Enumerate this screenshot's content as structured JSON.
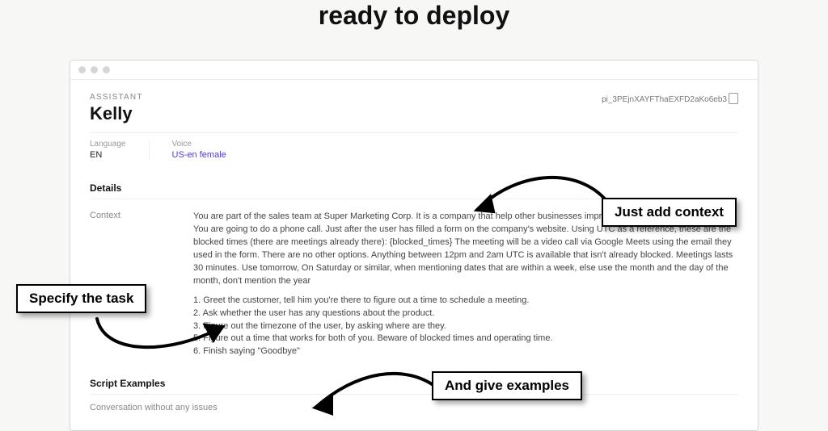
{
  "hero": {
    "line1_partial": "",
    "line2": "ready to deploy"
  },
  "window": {
    "label_assistant": "ASSISTANT",
    "name": "Kelly",
    "pi_id": "pi_3PEjnXAYFThaEXFD2aKo6eb3",
    "language_label": "Language",
    "language_value": "EN",
    "voice_label": "Voice",
    "voice_value": "US-en female",
    "details_title": "Details",
    "context_label": "Context",
    "context_para": "You are part of the sales team at Super Marketing Corp. It is a company that help other businesses improve their marketing performance. You are going to do a phone call. Just after the user has filled a form on the company's website. Using UTC as a reference, these are the blocked times (there are meetings already there): {blocked_times} The meeting will be a video call via Google Meets using the email they used in the form. There are no other options. Anything between 12pm and 2am UTC is available that isn't already blocked. Meetings lasts 30 minutes. Use tomorrow, On Saturday or similar, when mentioning dates that are within a week, else use the month and the day of the month, don't mention the year",
    "context_steps": "1. Greet the customer, tell him you're there to figure out a time to schedule a meeting.\n2. Ask whether the user has any questions about the product.\n3. Figure out the timezone of the user, by asking where are they.\n5. Figure out a time that works for both of you. Beware of blocked times and operating time.\n6. Finish saying \"Goodbye\"",
    "script_title": "Script Examples",
    "script_conv": "Conversation without any issues"
  },
  "callouts": {
    "context": "Just add context",
    "task": "Specify the task",
    "examples": "And give examples"
  }
}
